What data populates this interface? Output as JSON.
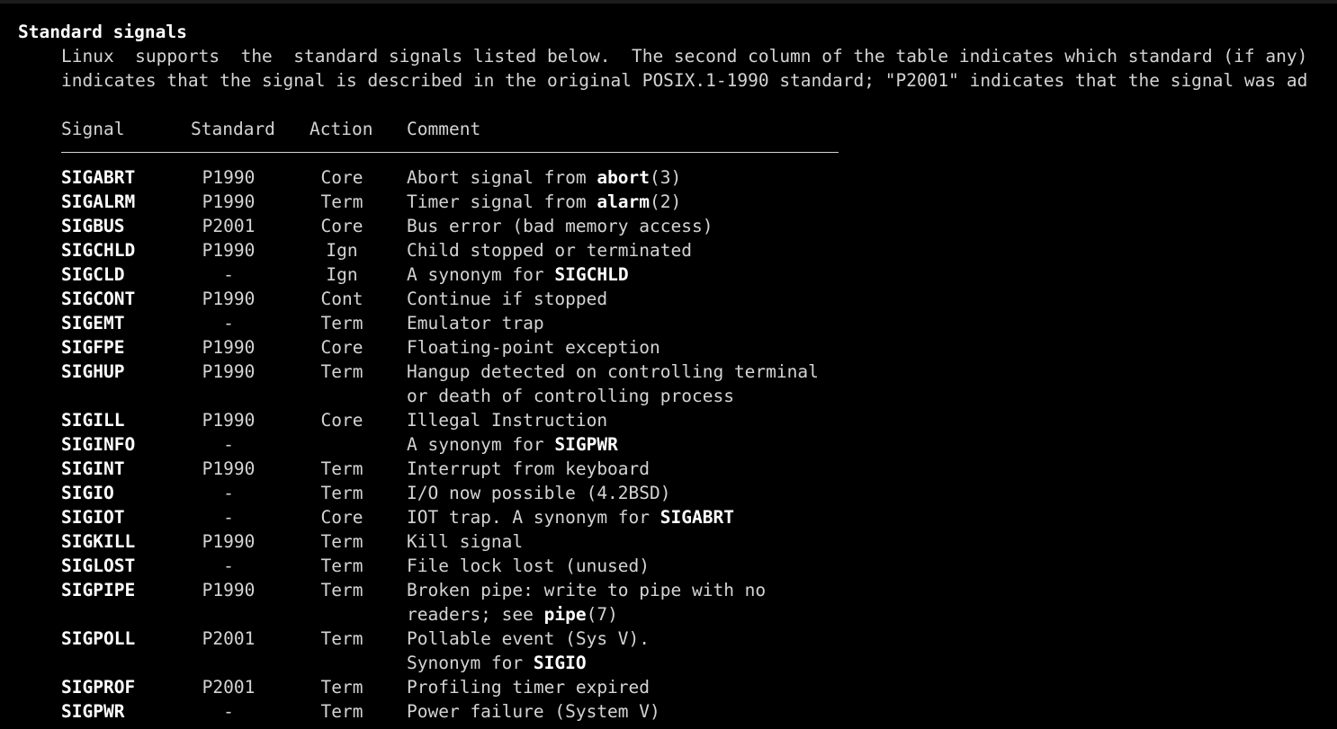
{
  "section_title": "Standard signals",
  "intro": {
    "line1": "Linux  supports  the  standard signals listed below.  The second column of the table indicates which standard (if any)",
    "line2": "indicates that the signal is described in the original POSIX.1-1990 standard; \"P2001\" indicates that the signal was ad"
  },
  "table": {
    "headers": {
      "signal": "Signal",
      "standard": "Standard",
      "action": "Action",
      "comment": "Comment"
    },
    "rows": [
      {
        "signal": "SIGABRT",
        "standard": "P1990",
        "action": "Core",
        "comment_a": "Abort signal from ",
        "comment_b": "abort",
        "comment_c": "(3)"
      },
      {
        "signal": "SIGALRM",
        "standard": "P1990",
        "action": "Term",
        "comment_a": "Timer signal from ",
        "comment_b": "alarm",
        "comment_c": "(2)"
      },
      {
        "signal": "SIGBUS",
        "standard": "P2001",
        "action": "Core",
        "comment_a": "Bus error (bad memory access)",
        "comment_b": "",
        "comment_c": ""
      },
      {
        "signal": "SIGCHLD",
        "standard": "P1990",
        "action": "Ign",
        "comment_a": "Child stopped or terminated",
        "comment_b": "",
        "comment_c": ""
      },
      {
        "signal": "SIGCLD",
        "standard": "-",
        "action": "Ign",
        "comment_a": "A synonym for ",
        "comment_b": "SIGCHLD",
        "comment_c": ""
      },
      {
        "signal": "SIGCONT",
        "standard": "P1990",
        "action": "Cont",
        "comment_a": "Continue if stopped",
        "comment_b": "",
        "comment_c": ""
      },
      {
        "signal": "SIGEMT",
        "standard": "-",
        "action": "Term",
        "comment_a": "Emulator trap",
        "comment_b": "",
        "comment_c": ""
      },
      {
        "signal": "SIGFPE",
        "standard": "P1990",
        "action": "Core",
        "comment_a": "Floating-point exception",
        "comment_b": "",
        "comment_c": ""
      },
      {
        "signal": "SIGHUP",
        "standard": "P1990",
        "action": "Term",
        "comment_a": "Hangup detected on controlling terminal",
        "comment_b": "",
        "comment_c": ""
      },
      {
        "signal": "",
        "standard": "",
        "action": "",
        "comment_a": "or death of controlling process",
        "comment_b": "",
        "comment_c": ""
      },
      {
        "signal": "SIGILL",
        "standard": "P1990",
        "action": "Core",
        "comment_a": "Illegal Instruction",
        "comment_b": "",
        "comment_c": ""
      },
      {
        "signal": "SIGINFO",
        "standard": "-",
        "action": "",
        "comment_a": "A synonym for ",
        "comment_b": "SIGPWR",
        "comment_c": ""
      },
      {
        "signal": "SIGINT",
        "standard": "P1990",
        "action": "Term",
        "comment_a": "Interrupt from keyboard",
        "comment_b": "",
        "comment_c": ""
      },
      {
        "signal": "SIGIO",
        "standard": "-",
        "action": "Term",
        "comment_a": "I/O now possible (4.2BSD)",
        "comment_b": "",
        "comment_c": ""
      },
      {
        "signal": "SIGIOT",
        "standard": "-",
        "action": "Core",
        "comment_a": "IOT trap. A synonym for ",
        "comment_b": "SIGABRT",
        "comment_c": ""
      },
      {
        "signal": "SIGKILL",
        "standard": "P1990",
        "action": "Term",
        "comment_a": "Kill signal",
        "comment_b": "",
        "comment_c": ""
      },
      {
        "signal": "SIGLOST",
        "standard": "-",
        "action": "Term",
        "comment_a": "File lock lost (unused)",
        "comment_b": "",
        "comment_c": ""
      },
      {
        "signal": "SIGPIPE",
        "standard": "P1990",
        "action": "Term",
        "comment_a": "Broken pipe: write to pipe with no",
        "comment_b": "",
        "comment_c": ""
      },
      {
        "signal": "",
        "standard": "",
        "action": "",
        "comment_a": "readers; see ",
        "comment_b": "pipe",
        "comment_c": "(7)"
      },
      {
        "signal": "SIGPOLL",
        "standard": "P2001",
        "action": "Term",
        "comment_a": "Pollable event (Sys V).",
        "comment_b": "",
        "comment_c": ""
      },
      {
        "signal": "",
        "standard": "",
        "action": "",
        "comment_a": "Synonym for ",
        "comment_b": "SIGIO",
        "comment_c": ""
      },
      {
        "signal": "SIGPROF",
        "standard": "P2001",
        "action": "Term",
        "comment_a": "Profiling timer expired",
        "comment_b": "",
        "comment_c": ""
      },
      {
        "signal": "SIGPWR",
        "standard": "-",
        "action": "Term",
        "comment_a": "Power failure (System V)",
        "comment_b": "",
        "comment_c": ""
      }
    ]
  }
}
